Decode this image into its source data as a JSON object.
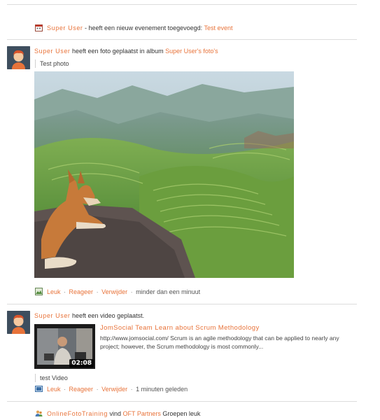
{
  "feed": {
    "event_item": {
      "icon": "calendar-icon",
      "user": "Super User",
      "text": " - heeft een nieuw evenement toegevoegd: ",
      "target": "Test event"
    },
    "photo_item": {
      "user": "Super User",
      "text": " heeft een foto geplaatst in album ",
      "target": "Super User's foto's",
      "caption": "Test photo",
      "actions": {
        "icon": "photo-icon",
        "like": "Leuk",
        "reply": "Reageer",
        "remove": "Verwijder",
        "time": "minder dan een minuut"
      },
      "sep": " · "
    },
    "video_item": {
      "user": "Super User",
      "text": " heeft een video geplaatst.",
      "video_title": "JomSocial Team Learn about Scrum Methodology",
      "video_desc": "http://www.jomsocial.com/ Scrum is an agile methodology that can be applied to nearly any project; however, the Scrum methodology is most commonly...",
      "duration": "02:08",
      "caption": "test Video",
      "actions": {
        "icon": "video-icon",
        "like": "Leuk",
        "reply": "Reageer",
        "remove": "Verwijder",
        "time": "1 minuten geleden"
      },
      "sep": " · "
    },
    "group_item": {
      "icon": "group-icon",
      "user": "OnlineFotoTraining",
      "text": " vind ",
      "target": "OFT Partners",
      "suffix": " Groepen leuk"
    }
  },
  "colors": {
    "link": "#e8733a",
    "divider": "#dcdcdc",
    "text": "#333333"
  }
}
